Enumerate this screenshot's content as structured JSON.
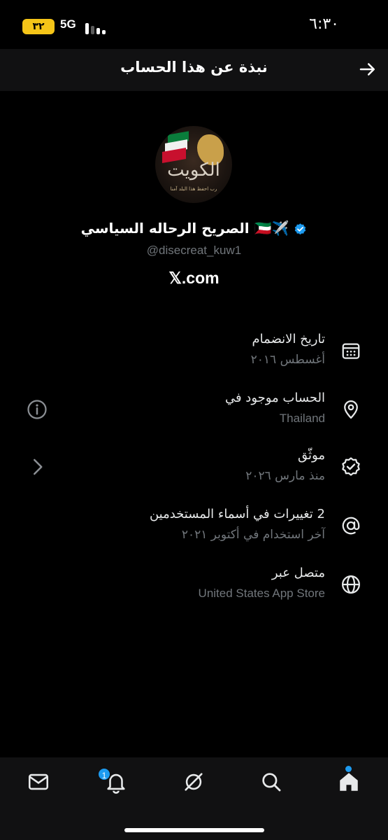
{
  "status_bar": {
    "time": "٦:٣٠",
    "battery": "٣٢",
    "network": "5G"
  },
  "header": {
    "title": "نبذة عن هذا الحساب"
  },
  "profile": {
    "display_name": "الصريح الرحاله السياسي 🇰🇼✈️",
    "handle": "@disecreat_kuw1",
    "platform": "𝕏.com",
    "avatar_text": "الكويت",
    "avatar_subtext": "رب احفظ هذا البلد آمنا"
  },
  "info_rows": [
    {
      "icon": "calendar-icon",
      "title": "تاريخ الانضمام",
      "subtitle": "أغسطس ٢٠١٦"
    },
    {
      "icon": "location-pin-icon",
      "title": "الحساب موجود في",
      "subtitle": "Thailand",
      "side_action": "info-icon"
    },
    {
      "icon": "verified-badge-icon",
      "title": "موثّق",
      "subtitle": "منذ مارس ٢٠٢٦",
      "side_action": "chevron-right-icon"
    },
    {
      "icon": "at-sign-icon",
      "title": "2 تغييرات في أسماء المستخدمين",
      "subtitle": "آخر استخدام في أكتوبر ٢٠٢١"
    },
    {
      "icon": "globe-icon",
      "title": "متصل عبر",
      "subtitle": "United States App Store"
    }
  ],
  "bottom_nav": {
    "notifications_badge": "1",
    "items": [
      "mail-icon",
      "bell-icon",
      "grok-icon",
      "search-icon",
      "home-icon"
    ]
  },
  "colors": {
    "background": "#000000",
    "bar": "#111112",
    "accent": "#1d9bf0",
    "secondary_text": "#71767b",
    "battery": "#f5c518"
  }
}
